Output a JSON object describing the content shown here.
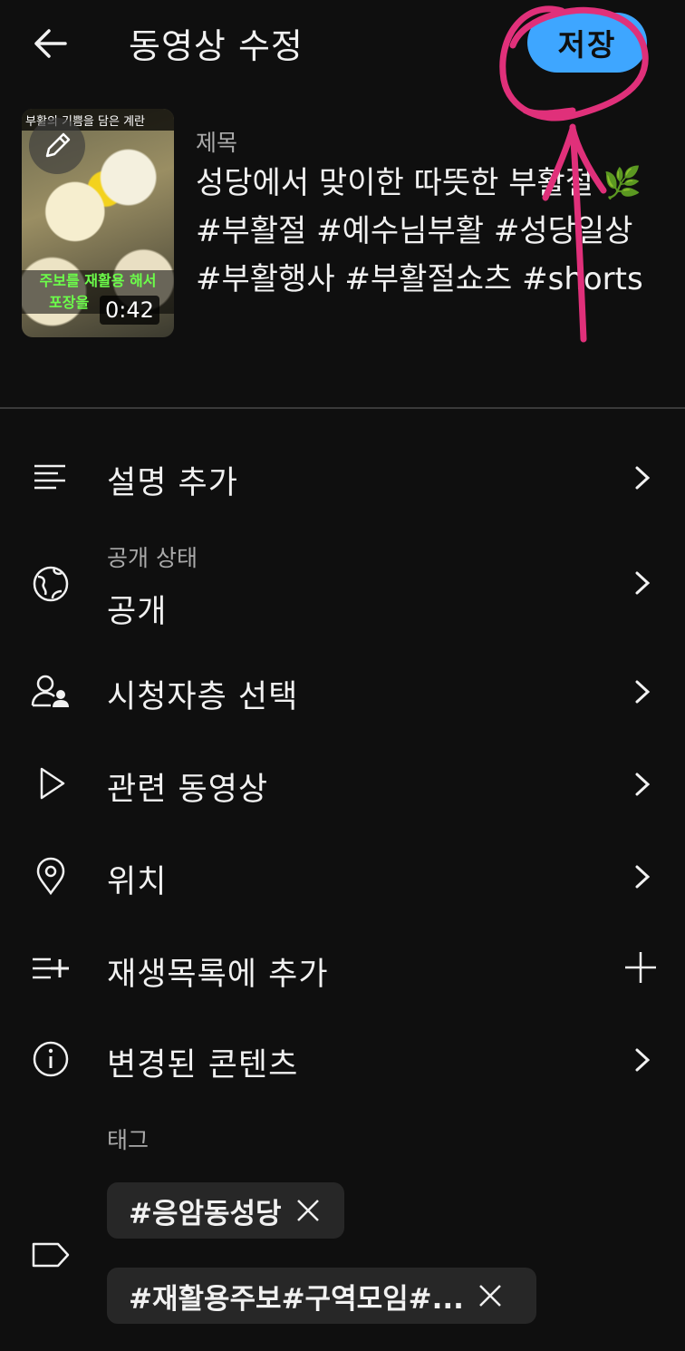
{
  "header": {
    "title": "동영상 수정",
    "save_label": "저장"
  },
  "video": {
    "thumbnail_top_caption": "부활의 기쁨을 담은 계란",
    "thumbnail_caption_line1": "주보를 재활용 해서",
    "thumbnail_caption_line2": "포장을",
    "duration": "0:42",
    "title_label": "제목",
    "title_text": "성당에서 맞이한 따뜻한 부활절 🌿#부활절 #예수님부활 #성당일상 #부활행사 #부활절쇼츠 #shorts"
  },
  "menu": {
    "description": {
      "label": "설명 추가",
      "icon": "description-lines-icon"
    },
    "visibility": {
      "sublabel": "공개 상태",
      "label": "공개",
      "icon": "globe-icon"
    },
    "audience": {
      "label": "시청자층 선택",
      "icon": "audience-icon"
    },
    "related": {
      "label": "관련 동영상",
      "icon": "play-outline-icon"
    },
    "location": {
      "label": "위치",
      "icon": "location-pin-icon"
    },
    "playlist": {
      "label": "재생목록에 추가",
      "icon": "playlist-add-icon"
    },
    "altered": {
      "label": "변경된 콘텐츠",
      "icon": "info-icon"
    }
  },
  "tags": {
    "label": "태그",
    "chips": [
      {
        "text": "#응암동성당"
      },
      {
        "text": "#재활용주보#구역모임#..."
      }
    ]
  },
  "colors": {
    "background": "#0f0f0f",
    "accent": "#3ea6ff",
    "chip_bg": "#272727",
    "annotation": "#e0307a"
  }
}
